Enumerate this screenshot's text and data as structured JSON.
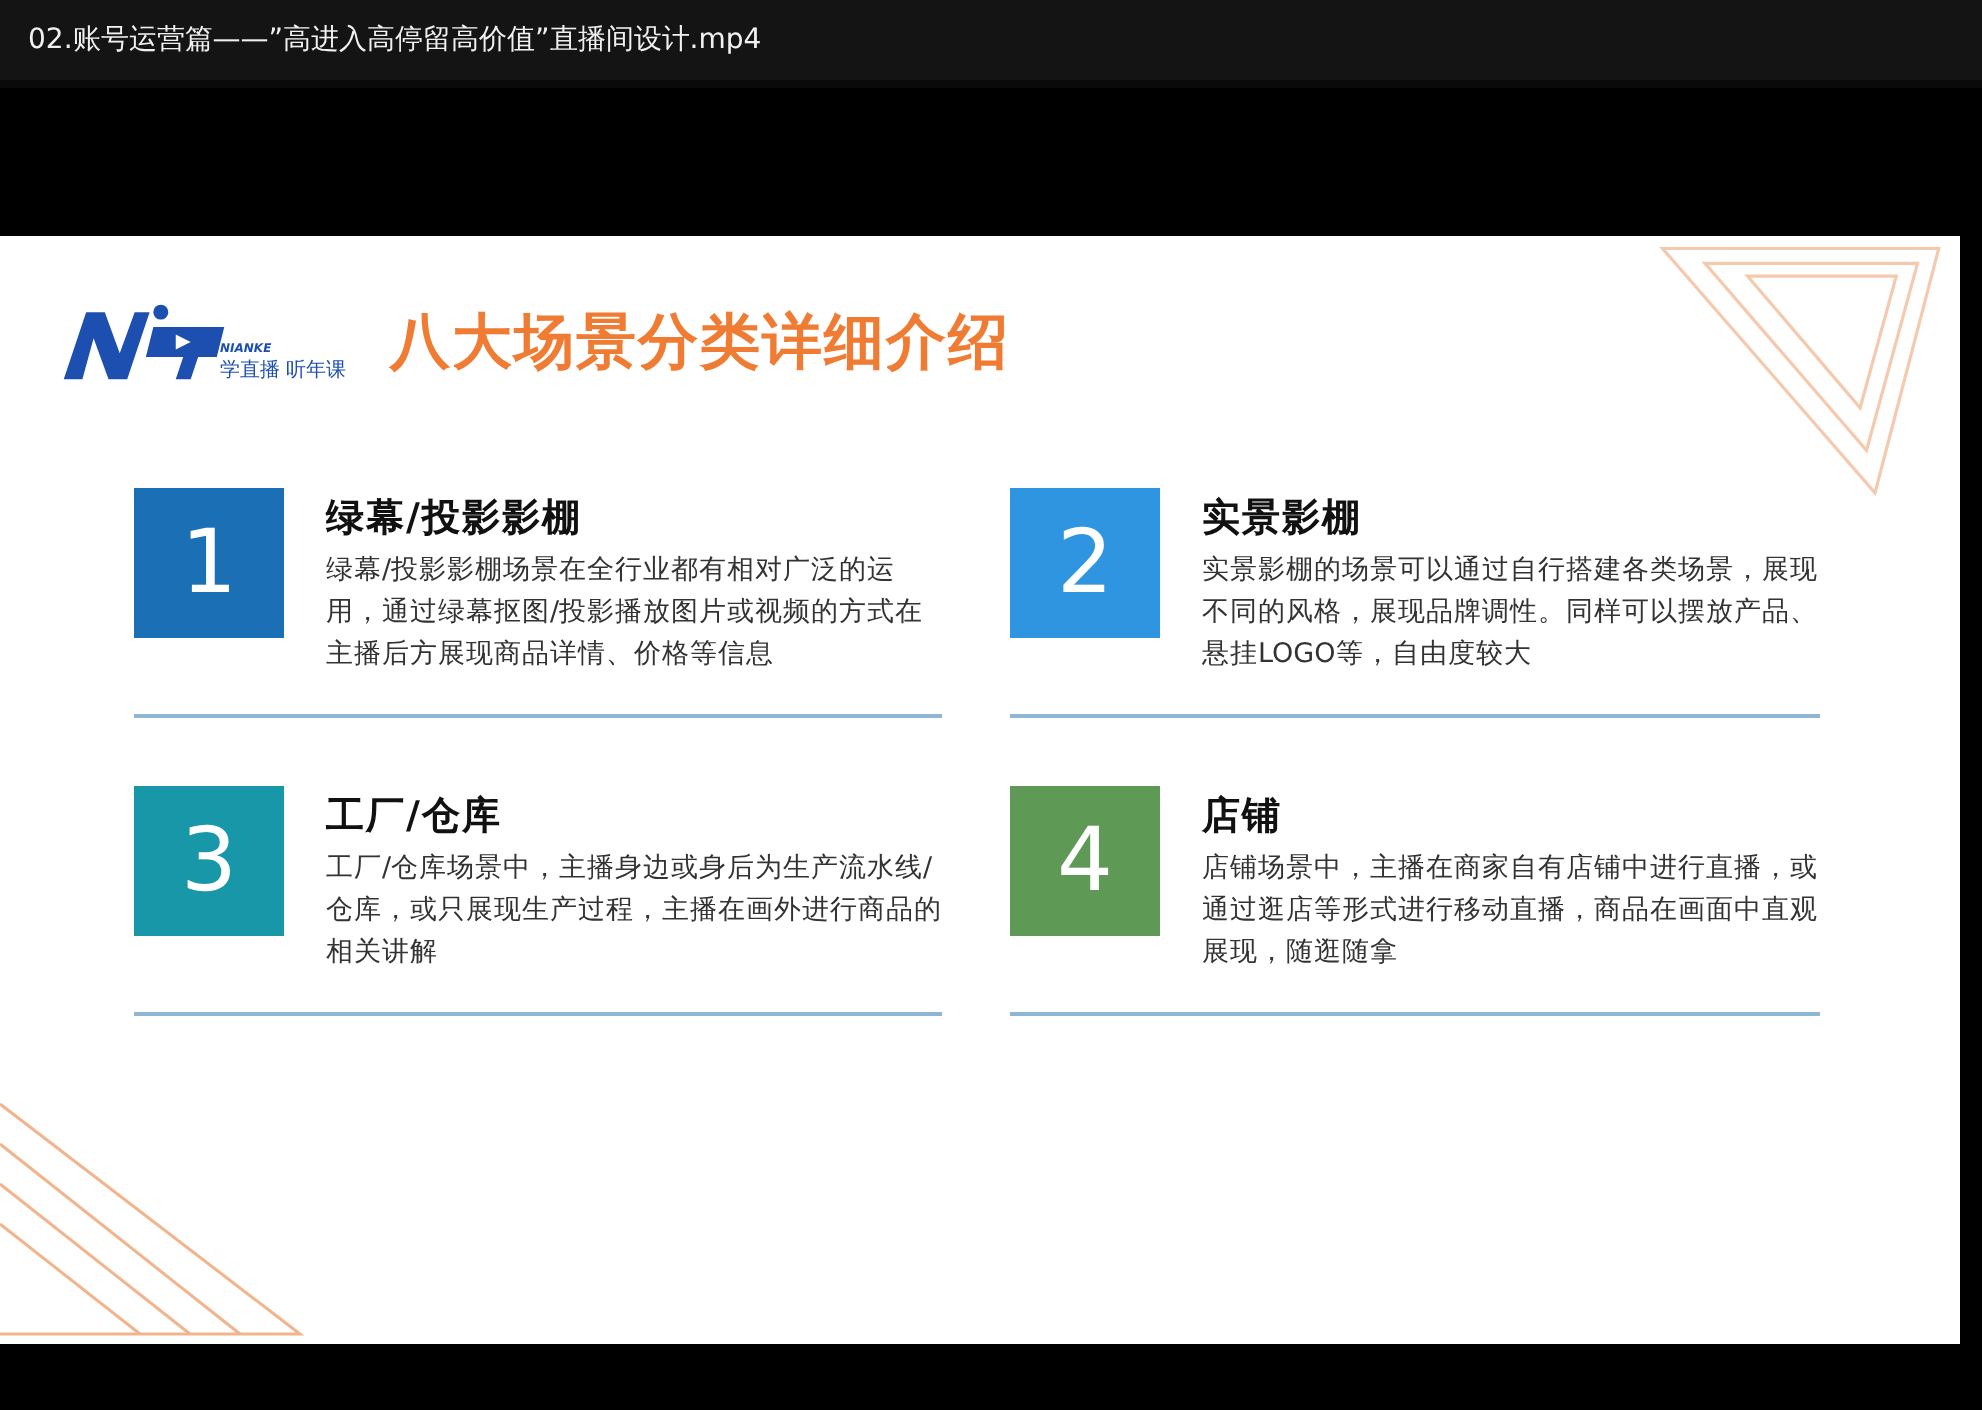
{
  "window": {
    "title": "02.账号运营篇——”高进入高停留高价值”直播间设计.mp4"
  },
  "slide": {
    "logo": {
      "brand": "NIANKE",
      "slogan": "学直播 听年课"
    },
    "title": "八大场景分类详细介绍",
    "scenes": [
      {
        "number": "1",
        "heading": "绿幕/投影影棚",
        "body": "绿幕/投影影棚场景在全行业都有相对广泛的运用，通过绿幕抠图/投影播放图片或视频的方式在主播后方展现商品详情、价格等信息",
        "color": "#1a6fb5"
      },
      {
        "number": "2",
        "heading": "实景影棚",
        "body": "实景影棚的场景可以通过自行搭建各类场景，展现不同的风格，展现品牌调性。同样可以摆放产品、悬挂LOGO等，自由度较大",
        "color": "#2f95e0"
      },
      {
        "number": "3",
        "heading": "工厂/仓库",
        "body": "工厂/仓库场景中，主播身边或身后为生产流水线/仓库，或只展现生产过程，主播在画外进行商品的相关讲解",
        "color": "#1797a8"
      },
      {
        "number": "4",
        "heading": "店铺",
        "body": "店铺场景中，主播在商家自有店铺中进行直播，或通过逛店等形式进行移动直播，商品在画面中直观展现，随逛随拿",
        "color": "#5e9a55"
      }
    ]
  }
}
